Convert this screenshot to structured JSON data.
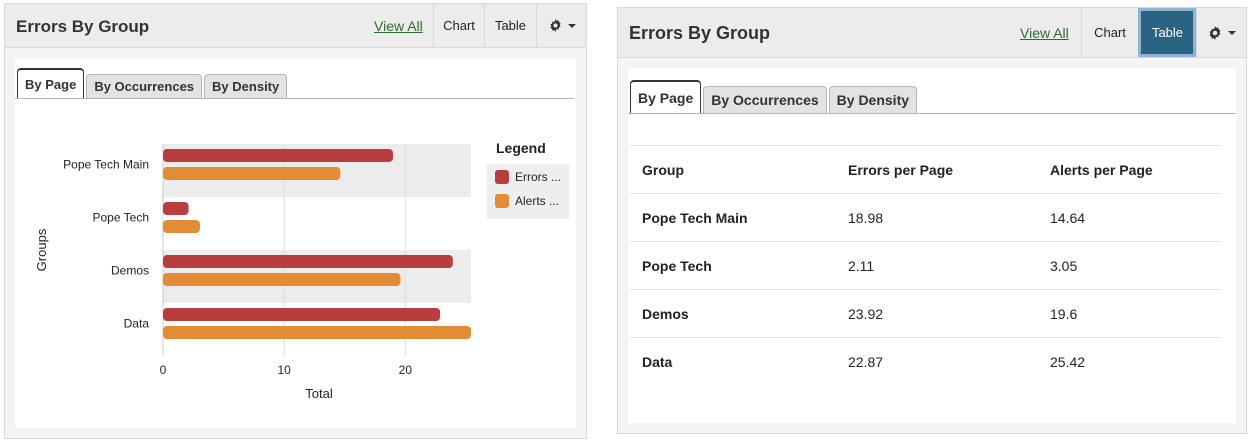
{
  "left": {
    "title": "Errors By Group",
    "view_all": "View All",
    "chart_btn": "Chart",
    "table_btn": "Table",
    "tabs": [
      {
        "label": "By Page"
      },
      {
        "label": "By Occurrences"
      },
      {
        "label": "By Density"
      }
    ]
  },
  "right": {
    "title": "Errors By Group",
    "view_all": "View All",
    "chart_btn": "Chart",
    "table_btn": "Table",
    "tabs": [
      {
        "label": "By Page"
      },
      {
        "label": "By Occurrences"
      },
      {
        "label": "By Density"
      }
    ],
    "table": {
      "headers": [
        "Group",
        "Errors per Page",
        "Alerts per Page"
      ],
      "rows": [
        [
          "Pope Tech Main",
          "18.98",
          "14.64"
        ],
        [
          "Pope Tech",
          "2.11",
          "3.05"
        ],
        [
          "Demos",
          "23.92",
          "19.6"
        ],
        [
          "Data",
          "22.87",
          "25.42"
        ]
      ]
    }
  },
  "colors": {
    "errors": "#b93d3f",
    "alerts": "#e38c35",
    "active_button": "#2b6482"
  },
  "icons": {
    "settings": "gear-icon",
    "dropdown": "chevron-down-icon"
  },
  "chart_data": {
    "type": "bar",
    "orientation": "horizontal",
    "categories": [
      "Pope Tech Main",
      "Pope Tech",
      "Demos",
      "Data"
    ],
    "series": [
      {
        "name": "Errors ...",
        "values": [
          18.98,
          2.11,
          23.92,
          22.87
        ]
      },
      {
        "name": "Alerts ...",
        "values": [
          14.64,
          3.05,
          19.6,
          25.42
        ]
      }
    ],
    "xlabel": "Total",
    "ylabel": "Groups",
    "xticks": [
      0,
      10,
      20
    ],
    "xlim": [
      0,
      25.42
    ],
    "legend_title": "Legend",
    "legend_position": "right",
    "grid": true
  }
}
